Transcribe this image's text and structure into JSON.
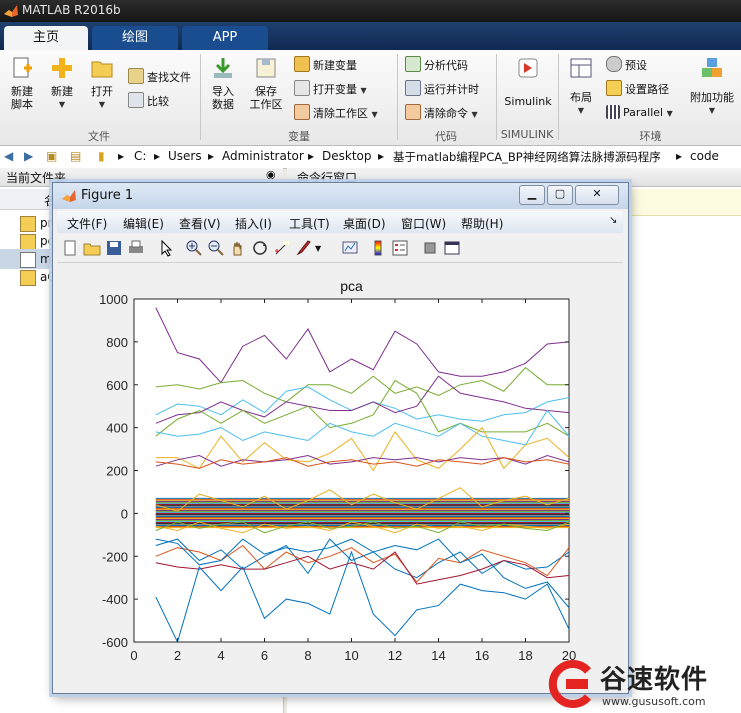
{
  "app": {
    "title": "MATLAB R2016b"
  },
  "tabs": [
    {
      "label": "主页",
      "active": true
    },
    {
      "label": "绘图",
      "active": false
    },
    {
      "label": "APP",
      "active": false
    }
  ],
  "ribbon": {
    "file": {
      "new_script": "新建\n脚本",
      "new": "新建",
      "open": "打开",
      "find_files": "查找文件",
      "compare": "比较",
      "group": "文件"
    },
    "variable": {
      "import": "导入\n数据",
      "save_workspace": "保存\n工作区",
      "new_variable": "新建变量",
      "open_variable": "打开变量",
      "clear_workspace": "清除工作区",
      "group": "变量"
    },
    "code": {
      "analyze": "分析代码",
      "run_time": "运行并计时",
      "clear_commands": "清除命令",
      "group": "代码"
    },
    "simulink": {
      "button": "Simulink",
      "group": "SIMULINK"
    },
    "environment": {
      "layout": "布局",
      "preferences": "预设",
      "set_path": "设置路径",
      "parallel": "Parallel",
      "addons": "附加功能",
      "group": "环境"
    }
  },
  "path": [
    "C:",
    "Users",
    "Administrator",
    "Desktop",
    "基于matlab编程PCA_BP神经网络算法脉搏源码程序",
    "code"
  ],
  "left_panel": {
    "title": "当前文件夹",
    "column": "名",
    "files": [
      "pr",
      "pc",
      "m",
      "aC"
    ]
  },
  "command_window": {
    "title": "命令行窗口"
  },
  "figure": {
    "title": "Figure 1",
    "menus": [
      "文件(F)",
      "编辑(E)",
      "查看(V)",
      "插入(I)",
      "工具(T)",
      "桌面(D)",
      "窗口(W)",
      "帮助(H)"
    ]
  },
  "watermark": {
    "brand": "谷速软件",
    "url": "www.gususoft.com"
  },
  "colors": {
    "series": [
      "#0072BD",
      "#D95319",
      "#EDB120",
      "#7E2F8E",
      "#77AC30",
      "#4DBEEE",
      "#A2142F"
    ]
  },
  "chart_data": {
    "type": "line",
    "title": "pca",
    "xlim": [
      0,
      20
    ],
    "ylim": [
      -600,
      1000
    ],
    "xticks": [
      0,
      2,
      4,
      6,
      8,
      10,
      12,
      14,
      16,
      18,
      20
    ],
    "yticks": [
      -600,
      -400,
      -200,
      0,
      200,
      400,
      600,
      800,
      1000
    ],
    "x": [
      1,
      2,
      3,
      4,
      5,
      6,
      7,
      8,
      9,
      10,
      11,
      12,
      13,
      14,
      15,
      16,
      17,
      18,
      19,
      20
    ],
    "series": [
      {
        "color": "#7E2F8E",
        "values": [
          960,
          750,
          720,
          610,
          780,
          830,
          720,
          860,
          660,
          720,
          670,
          850,
          790,
          660,
          640,
          640,
          660,
          700,
          790,
          800
        ]
      },
      {
        "color": "#77AC30",
        "values": [
          590,
          600,
          580,
          610,
          620,
          560,
          520,
          600,
          600,
          560,
          640,
          560,
          590,
          550,
          600,
          620,
          570,
          680,
          600,
          600
        ]
      },
      {
        "color": "#4DBEEE",
        "values": [
          460,
          510,
          500,
          460,
          530,
          470,
          570,
          590,
          530,
          480,
          520,
          490,
          440,
          460,
          440,
          430,
          460,
          470,
          520,
          540
        ]
      },
      {
        "color": "#7E2F8E",
        "values": [
          420,
          460,
          470,
          520,
          480,
          450,
          520,
          500,
          480,
          480,
          520,
          470,
          500,
          640,
          560,
          540,
          520,
          490,
          480,
          470
        ]
      },
      {
        "color": "#77AC30",
        "values": [
          360,
          440,
          480,
          420,
          480,
          420,
          460,
          500,
          400,
          420,
          460,
          620,
          560,
          380,
          420,
          380,
          380,
          380,
          420,
          360
        ]
      },
      {
        "color": "#4DBEEE",
        "values": [
          380,
          360,
          370,
          400,
          340,
          380,
          360,
          340,
          420,
          380,
          360,
          420,
          390,
          360,
          420,
          360,
          340,
          320,
          480,
          360
        ]
      },
      {
        "color": "#EDB120",
        "values": [
          260,
          260,
          210,
          360,
          240,
          330,
          250,
          240,
          280,
          350,
          200,
          380,
          250,
          210,
          300,
          400,
          210,
          320,
          350,
          260
        ]
      },
      {
        "color": "#7E2F8E",
        "values": [
          220,
          250,
          270,
          220,
          250,
          240,
          250,
          270,
          230,
          240,
          260,
          250,
          260,
          240,
          260,
          250,
          260,
          230,
          270,
          240
        ]
      },
      {
        "color": "#D95319",
        "values": [
          240,
          230,
          210,
          250,
          230,
          240,
          260,
          220,
          240,
          250,
          230,
          240,
          220,
          250,
          240,
          230,
          260,
          240,
          250,
          230
        ]
      },
      {
        "color": "#EDB120",
        "values": [
          40,
          10,
          90,
          60,
          30,
          80,
          20,
          60,
          110,
          40,
          90,
          50,
          20,
          70,
          120,
          30,
          60,
          80,
          40,
          70
        ]
      },
      {
        "color": "#0072BD",
        "values": [
          -150,
          -120,
          -220,
          -170,
          -260,
          -200,
          -150,
          -280,
          -120,
          -220,
          -180,
          -260,
          -300,
          -230,
          -180,
          -280,
          -220,
          -260,
          -250,
          -180
        ]
      },
      {
        "color": "#D95319",
        "values": [
          -200,
          -160,
          -180,
          -220,
          -150,
          -260,
          -180,
          -230,
          -200,
          -160,
          -230,
          -190,
          -320,
          -210,
          -230,
          -170,
          -200,
          -230,
          -290,
          -160
        ]
      },
      {
        "color": "#A2142F",
        "values": [
          -230,
          -250,
          -260,
          -240,
          -260,
          -260,
          -230,
          -200,
          -260,
          -230,
          -260,
          -180,
          -330,
          -310,
          -290,
          -260,
          -220,
          -240,
          -300,
          -290
        ]
      },
      {
        "color": "#0072BD",
        "values": [
          -120,
          -140,
          -240,
          -220,
          -120,
          -190,
          -160,
          -180,
          -160,
          -120,
          -180,
          -150,
          -170,
          -120,
          -230,
          -190,
          -300,
          -350,
          -320,
          -440
        ]
      },
      {
        "color": "#0072BD",
        "values": [
          -390,
          -600,
          -250,
          -360,
          -250,
          -490,
          -400,
          -420,
          -470,
          -180,
          -470,
          -570,
          -450,
          -430,
          -330,
          -360,
          -370,
          -400,
          -330,
          -540
        ]
      },
      {
        "color": "#EDB120",
        "values": [
          -60,
          -80,
          -40,
          -70,
          -90,
          -50,
          -70,
          -60,
          -80,
          -40,
          -60,
          -90,
          -50,
          -70,
          -60,
          -80,
          -50,
          -60,
          -70,
          -50
        ]
      },
      {
        "color": "#77AC30",
        "values": [
          -80,
          -40,
          -70,
          -50,
          -40,
          -90,
          -60,
          -40,
          -70,
          -60,
          -40,
          -70,
          -60,
          -90,
          -40,
          -60,
          -50,
          -70,
          -80,
          -40
        ]
      }
    ]
  }
}
